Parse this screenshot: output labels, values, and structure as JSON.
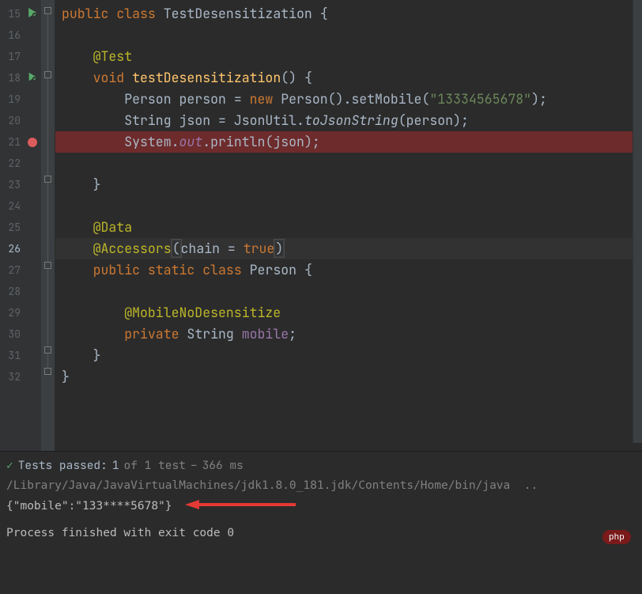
{
  "gutter": {
    "lines": [
      "15",
      "16",
      "17",
      "18",
      "19",
      "20",
      "21",
      "22",
      "23",
      "24",
      "25",
      "26",
      "27",
      "28",
      "29",
      "30",
      "31",
      "32"
    ]
  },
  "code": {
    "l0": {
      "kw1": "public",
      "kw2": "class",
      "name": "TestDesensitization",
      "open": "{"
    },
    "l2": {
      "ann": "@Test"
    },
    "l3": {
      "kw": "void",
      "name": "testDesensitization",
      "par": "()",
      "open": "{"
    },
    "l4": {
      "type": "Person",
      "var": "person",
      "eq": " = ",
      "kw": "new",
      "ctor": "Person",
      "par": "()",
      "dot": ".",
      "m": "setMobile",
      "po": "(",
      "str": "\"13334565678\"",
      "pc": ")",
      "semi": ";"
    },
    "l5": {
      "type": "String",
      "var": "json",
      "eq": " = ",
      "cls": "JsonUtil",
      "dot": ".",
      "m": "toJsonString",
      "po": "(",
      "arg": "person",
      "pc": ")",
      "semi": ";"
    },
    "l6": {
      "cls": "System",
      "dot1": ".",
      "fld": "out",
      "dot2": ".",
      "m": "println",
      "po": "(",
      "arg": "json",
      "pc": ")",
      "semi": ";"
    },
    "l8": {
      "close": "}"
    },
    "l10": {
      "ann": "@Data"
    },
    "l11": {
      "ann": "@Accessors",
      "po": "(",
      "k": "chain",
      "eq": " = ",
      "v": "true",
      "pc": ")"
    },
    "l12": {
      "kw1": "public",
      "kw2": "static",
      "kw3": "class",
      "name": "Person",
      "open": "{"
    },
    "l14": {
      "ann": "@MobileNoDesensitize"
    },
    "l15": {
      "kw": "private",
      "type": "String",
      "name": "mobile",
      "semi": ";"
    },
    "l16": {
      "close": "}"
    },
    "l17": {
      "close": "}"
    }
  },
  "tests": {
    "prefix": "Tests passed:",
    "count": "1",
    "of": "of 1 test",
    "dash": "–",
    "time": "366 ms"
  },
  "console": {
    "cmd": "/Library/Java/JavaVirtualMachines/jdk1.8.0_181.jdk/Contents/Home/bin/java  ..",
    "out": "{\"mobile\":\"133****5678\"}",
    "fin": "Process finished with exit code 0"
  },
  "logo": "php"
}
